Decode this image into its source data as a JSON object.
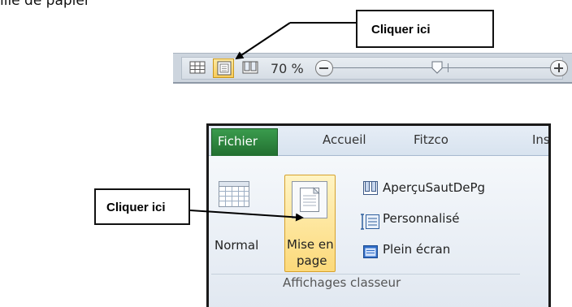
{
  "fragment_text": "ille de papier",
  "status_bar": {
    "zoom_percent": "70 %",
    "view_buttons": [
      "normal-view",
      "page-layout-view",
      "page-break-preview"
    ],
    "active_view": "page-layout-view",
    "zoom_level": 0.7
  },
  "callouts": {
    "top": "Cliquer ici",
    "left": "Cliquer ici"
  },
  "ribbon": {
    "tabs": [
      "Fichier",
      "Accueil",
      "Fitzco",
      "Ins"
    ],
    "active_tab": "Fichier",
    "buttons": {
      "normal": "Normal",
      "mise_en_page_line1": "Mise en",
      "mise_en_page_line2": "page",
      "apercu": "AperçuSautDePg",
      "personnalise": "Personnalisé",
      "plein_ecran": "Plein écran"
    },
    "group_label": "Affichages classeur"
  },
  "colors": {
    "fichier_tab": "#2e8a40",
    "active_highlight": "#fcd97a",
    "statusbar": "#cdd5de"
  }
}
